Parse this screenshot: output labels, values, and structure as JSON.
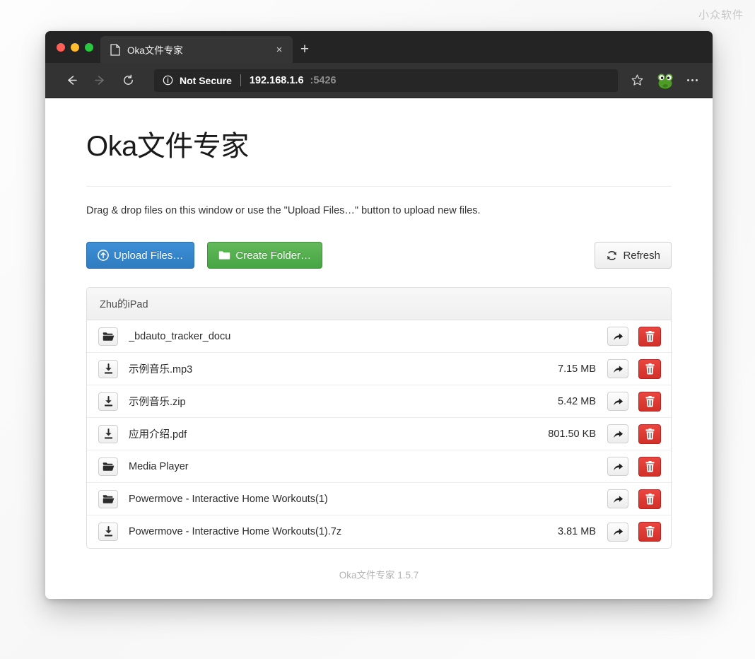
{
  "watermark": "小众软件",
  "browser": {
    "tab": {
      "title": "Oka文件专家",
      "favicon_icon": "document-icon",
      "close_icon": "close-icon",
      "close_label": "×"
    },
    "new_tab_label": "+",
    "toolbar": {
      "back_icon": "arrow-left-icon",
      "forward_icon": "arrow-right-icon",
      "reload_icon": "reload-icon",
      "security_icon": "info-circle-icon",
      "security_text": "Not Secure",
      "url_host": "192.168.1.6",
      "url_port": ":5426",
      "bookmark_icon": "star-icon",
      "extension_icon": "frog-avatar-icon",
      "menu_icon": "more-options-icon"
    }
  },
  "app": {
    "title": "Oka文件专家",
    "hint": "Drag & drop files on this window or use the \"Upload Files…\" button to upload new files.",
    "buttons": {
      "upload": {
        "label": "Upload Files…",
        "icon": "upload-circle-icon",
        "color": "#3580c8"
      },
      "create_folder": {
        "label": "Create Folder…",
        "icon": "folder-icon",
        "color": "#51ac4c"
      },
      "refresh": {
        "label": "Refresh",
        "icon": "refresh-icon",
        "color": "#f3f3f3"
      }
    },
    "panel_header": "Zhu的iPad",
    "rows": [
      {
        "name": "_bdauto_tracker_docu",
        "size": "",
        "type": "folder",
        "icon": "open-folder-icon"
      },
      {
        "name": "示例音乐.mp3",
        "size": "7.15 MB",
        "type": "file",
        "icon": "download-icon"
      },
      {
        "name": "示例音乐.zip",
        "size": "5.42 MB",
        "type": "file",
        "icon": "download-icon"
      },
      {
        "name": "应用介绍.pdf",
        "size": "801.50 KB",
        "type": "file",
        "icon": "download-icon"
      },
      {
        "name": "Media Player",
        "size": "",
        "type": "folder",
        "icon": "open-folder-icon"
      },
      {
        "name": "Powermove - Interactive Home Workouts(1)",
        "size": "",
        "type": "folder",
        "icon": "open-folder-icon"
      },
      {
        "name": "Powermove - Interactive Home Workouts(1).7z",
        "size": "3.81 MB",
        "type": "file",
        "icon": "download-icon"
      }
    ],
    "row_actions": {
      "share_icon": "share-arrow-icon",
      "delete_icon": "trash-icon"
    },
    "footer": "Oka文件专家 1.5.7"
  }
}
